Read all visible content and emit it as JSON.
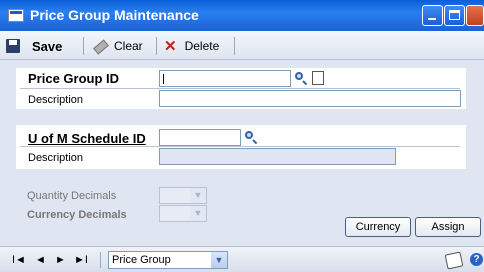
{
  "window": {
    "title": "Price Group Maintenance"
  },
  "toolbar": {
    "save_label": "Save",
    "clear_label": "Clear",
    "delete_label": "Delete"
  },
  "form": {
    "price_group_id_label": "Price Group ID",
    "price_group_id_value": "",
    "description_label": "Description",
    "description_value": "",
    "uofm_label": "U of M Schedule ID",
    "uofm_value": "",
    "uofm_description_label": "Description",
    "uofm_description_value": "",
    "quantity_decimals_label": "Quantity Decimals",
    "currency_decimals_label": "Currency Decimals"
  },
  "buttons": {
    "currency": "Currency",
    "assign": "Assign"
  },
  "statusbar": {
    "nav_first": "I◄",
    "nav_prev": "◄",
    "nav_next": "►",
    "nav_last": "►I",
    "sort_by": "Price Group"
  }
}
